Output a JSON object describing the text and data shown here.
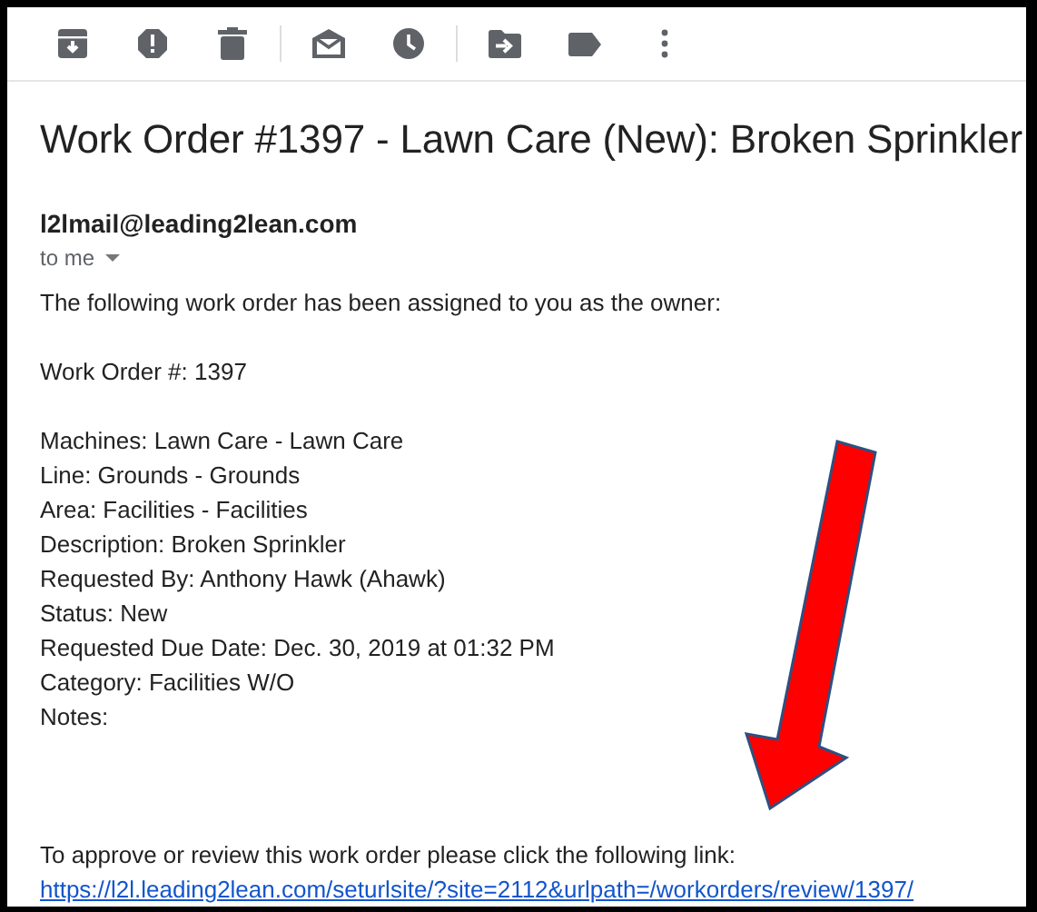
{
  "subject": "Work Order #1397 - Lawn Care (New): Broken Sprinkler",
  "sender": "l2lmail@leading2lean.com",
  "recipient": "to me",
  "paragraphs": [
    {
      "lines": [
        "The following work order has been assigned to you as the owner:"
      ]
    },
    {
      "lines": [
        "Work Order #: 1397"
      ]
    },
    {
      "lines": [
        "Machines: Lawn Care - Lawn Care",
        "Line: Grounds - Grounds",
        "Area: Facilities - Facilities",
        "Description: Broken Sprinkler",
        "Requested By: Anthony Hawk (Ahawk)",
        "Status: New",
        "Requested Due Date: Dec. 30, 2019 at 01:32 PM",
        "Category: Facilities W/O",
        "Notes:"
      ]
    },
    {
      "lines": [
        "To approve or review this work order please click the following link:"
      ],
      "link": "https://l2l.leading2lean.com/seturlsite/?site=2112&urlpath=/workorders/review/1397/"
    }
  ]
}
